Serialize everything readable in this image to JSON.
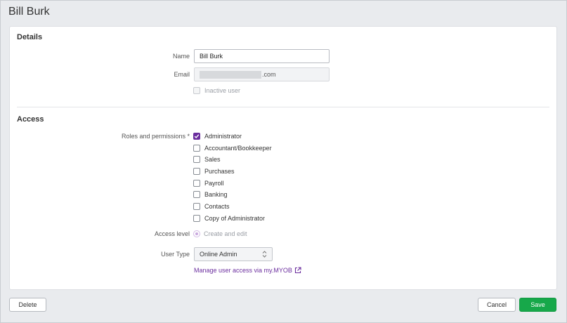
{
  "header": {
    "title": "Bill Burk"
  },
  "details": {
    "heading": "Details",
    "name_label": "Name",
    "name_value": "Bill Burk",
    "email_label": "Email",
    "email_suffix": ".com",
    "inactive_label": "Inactive user",
    "inactive_checked": false
  },
  "access": {
    "heading": "Access",
    "roles_label": "Roles and permissions *",
    "roles": [
      {
        "label": "Administrator",
        "checked": true
      },
      {
        "label": "Accountant/Bookkeeper",
        "checked": false
      },
      {
        "label": "Sales",
        "checked": false
      },
      {
        "label": "Purchases",
        "checked": false
      },
      {
        "label": "Payroll",
        "checked": false
      },
      {
        "label": "Banking",
        "checked": false
      },
      {
        "label": "Contacts",
        "checked": false
      },
      {
        "label": "Copy of Administrator",
        "checked": false
      }
    ],
    "access_level_label": "Access level",
    "access_level_value": "Create and edit",
    "user_type_label": "User Type",
    "user_type_value": "Online Admin",
    "manage_link": "Manage user access via my.MYOB"
  },
  "footer": {
    "delete_label": "Delete",
    "cancel_label": "Cancel",
    "save_label": "Save"
  },
  "colors": {
    "accent": "#6b2e9e",
    "save_green": "#17a84a",
    "background": "#e9ebee"
  },
  "icons": {
    "checkmark": "check-icon",
    "external_link": "external-link-icon",
    "select_arrows": "chevron-updown-icon"
  }
}
